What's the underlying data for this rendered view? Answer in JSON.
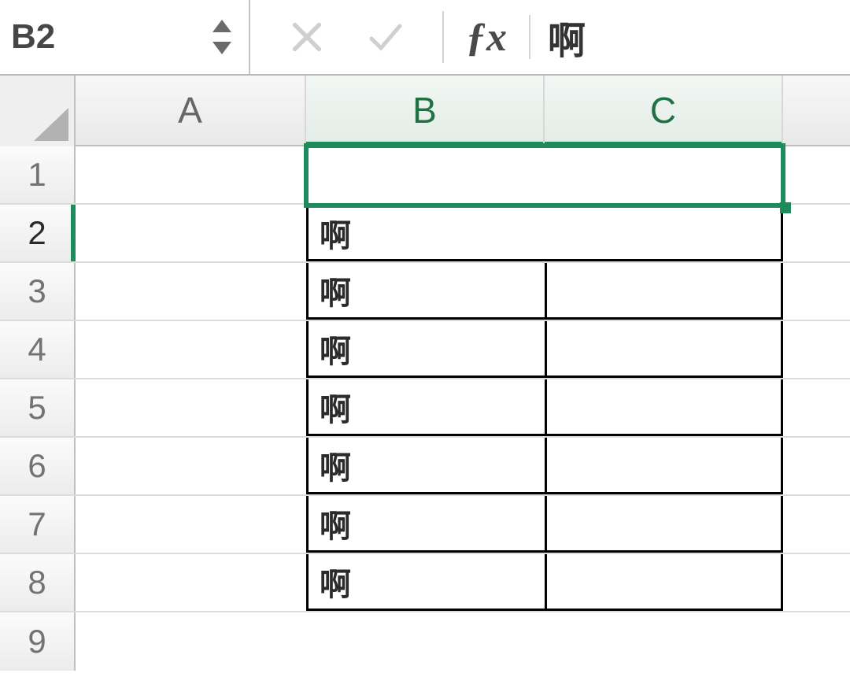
{
  "formula_bar": {
    "name_box": "B2",
    "fx_label": "ƒx",
    "value": "啊"
  },
  "columns": [
    "A",
    "B",
    "C"
  ],
  "selected_cell": "B2",
  "selected_columns": [
    "B",
    "C"
  ],
  "selected_row": 2,
  "rows": [
    {
      "num": 1
    },
    {
      "num": 2,
      "B": "啊",
      "merged_BC": true
    },
    {
      "num": 3,
      "B": "啊"
    },
    {
      "num": 4,
      "B": "啊"
    },
    {
      "num": 5,
      "B": "啊"
    },
    {
      "num": 6,
      "B": "啊"
    },
    {
      "num": 7,
      "B": "啊"
    },
    {
      "num": 8,
      "B": "啊"
    },
    {
      "num": 9
    }
  ],
  "bordered_range": "B2:C8",
  "colors": {
    "selection": "#1f8a5a"
  }
}
